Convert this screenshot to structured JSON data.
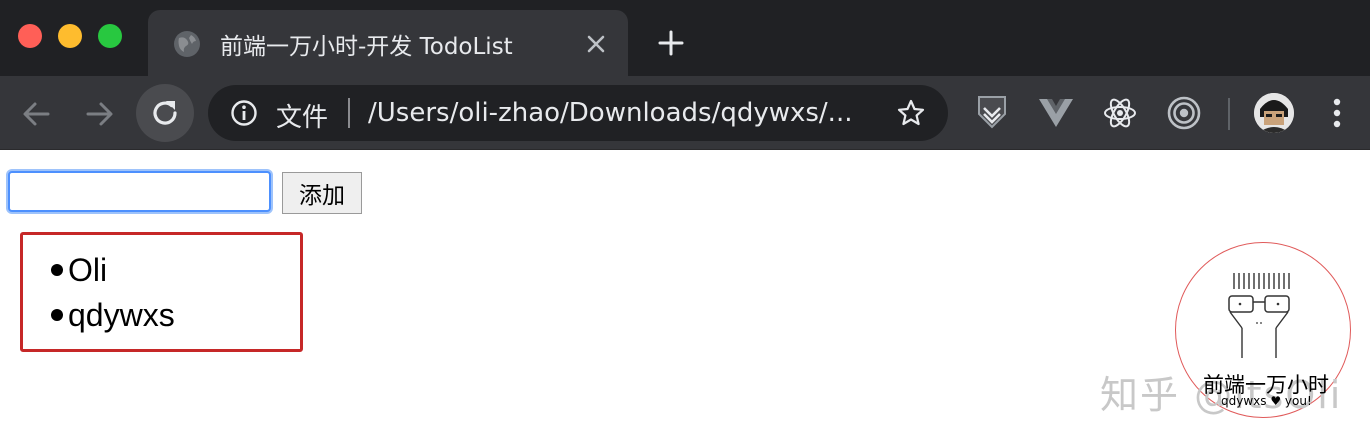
{
  "window": {
    "tab_title": "前端一万小时-开发 TodoList",
    "new_tab_icon": "plus-icon",
    "favicon_icon": "globe-icon"
  },
  "toolbar": {
    "omnibox": {
      "scheme_label": "文件",
      "url": "/Users/oli-zhao/Downloads/qdywxs/...",
      "info_icon": "info-icon",
      "bookmark_icon": "star-icon"
    },
    "extensions": [
      "dark-shield-extension-icon",
      "vue-devtools-icon",
      "react-devtools-icon",
      "target-extension-icon"
    ],
    "colors": {
      "frame": "#202124",
      "toolbar": "#35363a",
      "text": "#e8eaed"
    }
  },
  "page": {
    "input_value": "",
    "add_button_label": "添加",
    "todo_items": [
      "Oli",
      "qdywxs"
    ],
    "highlight_color": "#c62828"
  },
  "watermark": {
    "site_text": "知乎 @itsOli",
    "title": "前端一万小时",
    "subtitle": "qdywxs ♥ you!"
  }
}
